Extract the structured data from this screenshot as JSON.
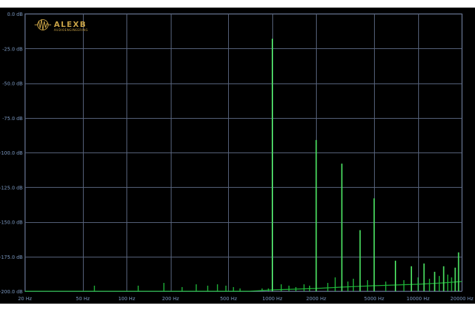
{
  "logo": {
    "brand": "ALEXB",
    "sub": "AUDIOENGINEERING"
  },
  "colors": {
    "background": "#000000",
    "grid": "#5a6680",
    "tick_label": "#7d9ac3",
    "trace": "#1fb83a",
    "trace_bright": "#4be062",
    "logo_gold": "#c8a246"
  },
  "chart_data": {
    "type": "line",
    "title": "",
    "xlabel": "",
    "ylabel": "",
    "x_scale": "log",
    "xlim": [
      20,
      20000
    ],
    "ylim": [
      -200,
      0
    ],
    "grid": true,
    "x_ticks": [
      {
        "value": 20,
        "label": "20 Hz"
      },
      {
        "value": 50,
        "label": "50 Hz"
      },
      {
        "value": 100,
        "label": "100 Hz"
      },
      {
        "value": 200,
        "label": "200 Hz"
      },
      {
        "value": 500,
        "label": "500 Hz"
      },
      {
        "value": 1000,
        "label": "1000 Hz"
      },
      {
        "value": 2000,
        "label": "2000 Hz"
      },
      {
        "value": 5000,
        "label": "5000 Hz"
      },
      {
        "value": 10000,
        "label": "10000 Hz"
      },
      {
        "value": 20000,
        "label": "20000 Hz"
      }
    ],
    "y_ticks": [
      {
        "value": 0,
        "label": "0.0 dB"
      },
      {
        "value": -25,
        "label": "-25.0 dB"
      },
      {
        "value": -50,
        "label": "-50.0 dB"
      },
      {
        "value": -75,
        "label": "-75.0 dB"
      },
      {
        "value": -100,
        "label": "-100.0 dB"
      },
      {
        "value": -125,
        "label": "-125.0 dB"
      },
      {
        "value": -150,
        "label": "-150.0 dB"
      },
      {
        "value": -175,
        "label": "-175.0 dB"
      },
      {
        "value": -200,
        "label": "-200.0 dB"
      }
    ],
    "series": [
      {
        "peaks": [
          {
            "x": 1000,
            "y": -18
          },
          {
            "x": 2000,
            "y": -91
          },
          {
            "x": 3000,
            "y": -108
          },
          {
            "x": 4000,
            "y": -156
          },
          {
            "x": 5000,
            "y": -133
          },
          {
            "x": 7000,
            "y": -178
          },
          {
            "x": 9000,
            "y": -182
          },
          {
            "x": 11000,
            "y": -180
          },
          {
            "x": 13000,
            "y": -186
          },
          {
            "x": 15000,
            "y": -182
          },
          {
            "x": 18000,
            "y": -183
          },
          {
            "x": 19000,
            "y": -172
          }
        ],
        "spurs": [
          {
            "x": 60,
            "y": -196
          },
          {
            "x": 120,
            "y": -196
          },
          {
            "x": 180,
            "y": -194
          },
          {
            "x": 240,
            "y": -197
          },
          {
            "x": 300,
            "y": -195
          },
          {
            "x": 360,
            "y": -196
          },
          {
            "x": 420,
            "y": -195
          },
          {
            "x": 480,
            "y": -196
          },
          {
            "x": 540,
            "y": -197
          },
          {
            "x": 600,
            "y": -198
          },
          {
            "x": 850,
            "y": -198
          },
          {
            "x": 940,
            "y": -198
          },
          {
            "x": 1150,
            "y": -195
          },
          {
            "x": 1300,
            "y": -196
          },
          {
            "x": 1450,
            "y": -197
          },
          {
            "x": 1650,
            "y": -195
          },
          {
            "x": 1800,
            "y": -196
          },
          {
            "x": 2400,
            "y": -194
          },
          {
            "x": 2700,
            "y": -190
          },
          {
            "x": 3300,
            "y": -193
          },
          {
            "x": 3600,
            "y": -191
          },
          {
            "x": 4500,
            "y": -192
          },
          {
            "x": 6000,
            "y": -193
          },
          {
            "x": 8000,
            "y": -192
          },
          {
            "x": 10000,
            "y": -190
          },
          {
            "x": 12000,
            "y": -191
          },
          {
            "x": 14000,
            "y": -189
          },
          {
            "x": 16000,
            "y": -188
          },
          {
            "x": 17000,
            "y": -190
          }
        ],
        "floor": [
          {
            "x": 20,
            "y": -200
          },
          {
            "x": 700,
            "y": -200
          },
          {
            "x": 1000,
            "y": -199
          },
          {
            "x": 2000,
            "y": -198
          },
          {
            "x": 3000,
            "y": -197
          },
          {
            "x": 5000,
            "y": -196
          },
          {
            "x": 10000,
            "y": -195
          },
          {
            "x": 15000,
            "y": -194
          },
          {
            "x": 20000,
            "y": -193
          }
        ]
      }
    ]
  }
}
